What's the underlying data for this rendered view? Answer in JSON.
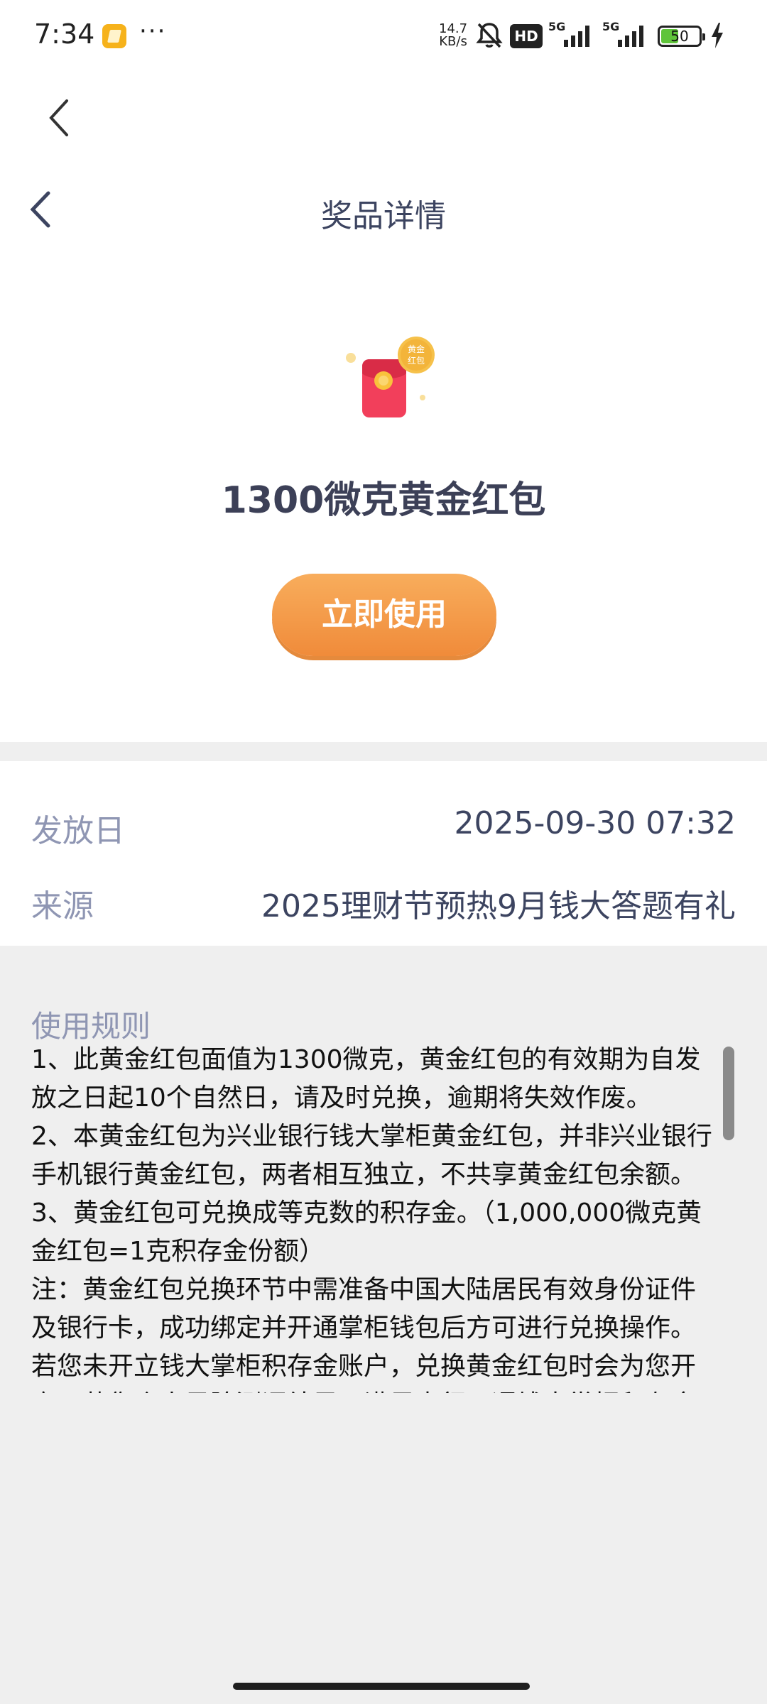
{
  "status_bar": {
    "time": "7:34",
    "net_speed_value": "14.7",
    "net_speed_unit": "KB/s",
    "hd_label": "HD",
    "signal_1_label": "5G",
    "signal_2_label": "5G",
    "battery_level": "50",
    "battery_percent": 50,
    "battery_color": "#5fc43a"
  },
  "header": {
    "title": "奖品详情",
    "back_icon": "chevron-left-icon"
  },
  "prize": {
    "icon": "gold-red-envelope-icon",
    "badge_text_line1": "黄金",
    "badge_text_line2": "红包",
    "name": "1300微克黄金红包",
    "action_label": "立即使用",
    "action_color": "#f39a46"
  },
  "info": {
    "issue_date_label": "发放日",
    "issue_date_value": "2025-09-30 07:32",
    "source_label": "来源",
    "source_value": "2025理财节预热9月钱大答题有礼"
  },
  "rules": {
    "title": "使用规则",
    "paragraphs": [
      "1、此黄金红包面值为1300微克，黄金红包的有效期为自发放之日起10个自然日，请及时兑换，逾期将失效作废。",
      "2、本黄金红包为兴业银行钱大掌柜黄金红包，并非兴业银行手机银行黄金红包，两者相互独立，不共享黄金红包余额。",
      "3、黄金红包可兑换成等克数的积存金。（1,000,000微克黄金红包=1克积存金份额）",
      "注：黄金红包兑换环节中需准备中国大陆居民有效身份证件及银行卡，成功绑定并开通掌柜钱包后方可进行兑换操作。若您未开立钱大掌柜积存金账户，兑换黄金红包时会为您开立。若您个人风险测评结果不满足本行开通钱大掌柜积存金要求，则"
    ]
  }
}
